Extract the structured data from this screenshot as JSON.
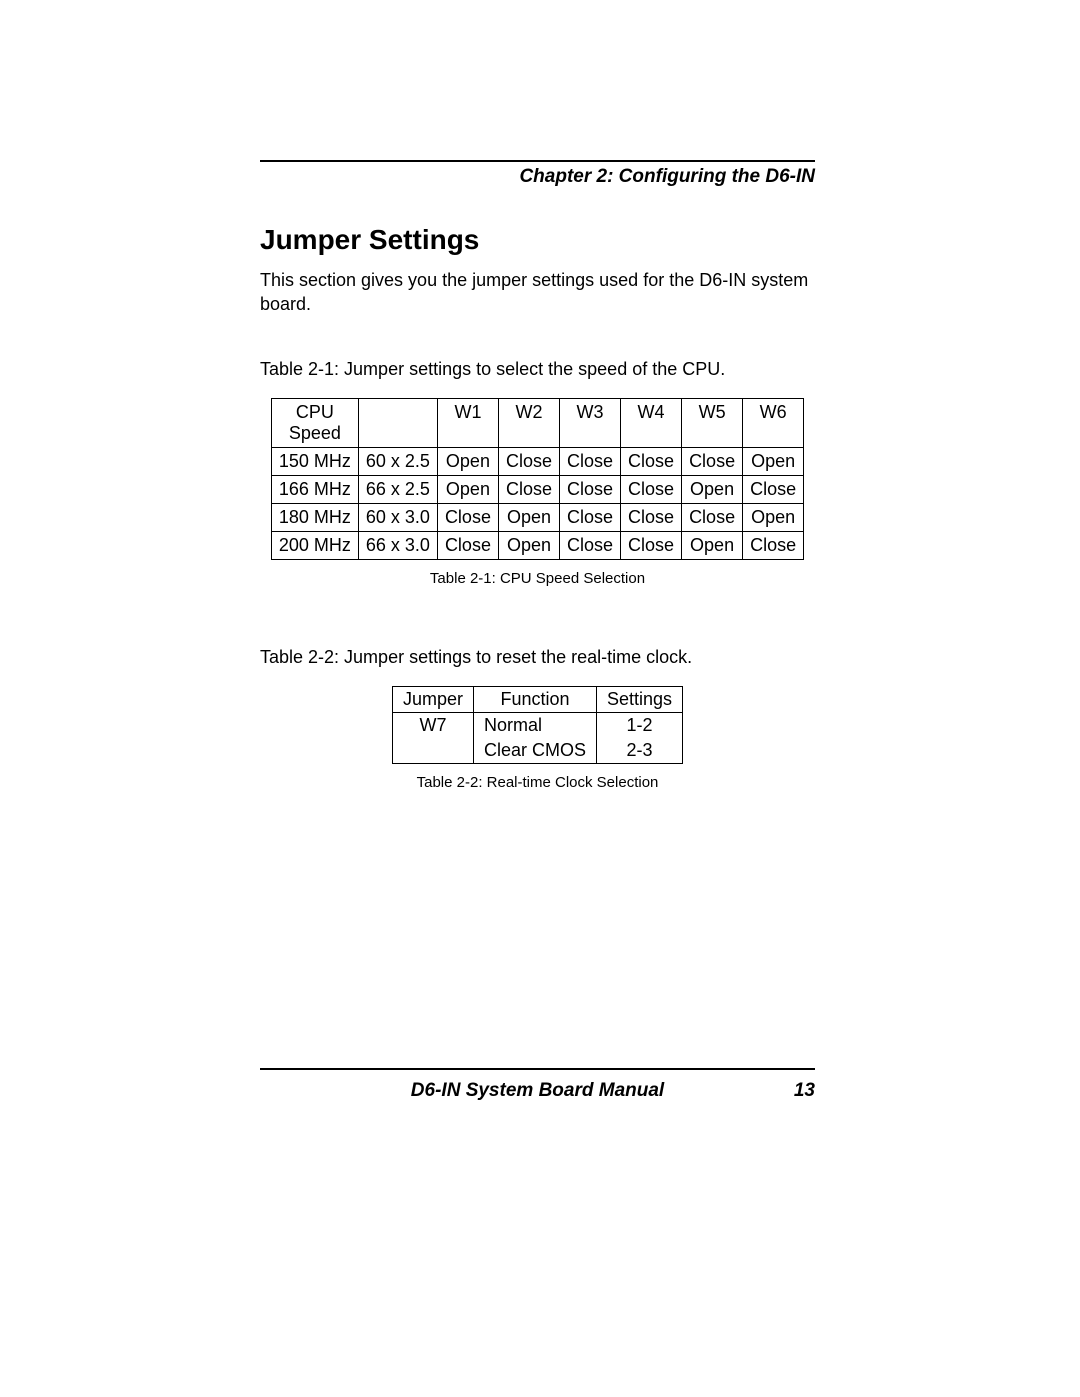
{
  "header": {
    "chapter_title": "Chapter 2: Configuring the D6-IN"
  },
  "section": {
    "title": "Jumper Settings",
    "intro": "This section gives you the jumper settings used for the D6-IN system board."
  },
  "table1": {
    "intro": "Table 2-1: Jumper settings to select the speed of the CPU.",
    "head": {
      "speed": "CPU Speed",
      "multiplier": "",
      "w1": "W1",
      "w2": "W2",
      "w3": "W3",
      "w4": "W4",
      "w5": "W5",
      "w6": "W6"
    },
    "rows": [
      {
        "speed": "150 MHz",
        "mult": "60 x 2.5",
        "w1": "Open",
        "w2": "Close",
        "w3": "Close",
        "w4": "Close",
        "w5": "Close",
        "w6": "Open"
      },
      {
        "speed": "166 MHz",
        "mult": "66 x 2.5",
        "w1": "Open",
        "w2": "Close",
        "w3": "Close",
        "w4": "Close",
        "w5": "Open",
        "w6": "Close"
      },
      {
        "speed": "180 MHz",
        "mult": "60 x 3.0",
        "w1": "Close",
        "w2": "Open",
        "w3": "Close",
        "w4": "Close",
        "w5": "Close",
        "w6": "Open"
      },
      {
        "speed": "200 MHz",
        "mult": "66 x 3.0",
        "w1": "Close",
        "w2": "Open",
        "w3": "Close",
        "w4": "Close",
        "w5": "Open",
        "w6": "Close"
      }
    ],
    "caption": "Table 2-1: CPU Speed Selection"
  },
  "table2": {
    "intro": "Table 2-2: Jumper settings to reset the real-time clock.",
    "head": {
      "jumper": "Jumper",
      "function": "Function",
      "settings": "Settings"
    },
    "rows": [
      {
        "jumper": "W7",
        "function": "Normal",
        "settings": "1-2"
      },
      {
        "jumper": "",
        "function": "Clear CMOS",
        "settings": "2-3"
      }
    ],
    "caption": "Table 2-2: Real-time Clock Selection"
  },
  "footer": {
    "manual_title": "D6-IN System Board Manual",
    "page_number": "13"
  }
}
